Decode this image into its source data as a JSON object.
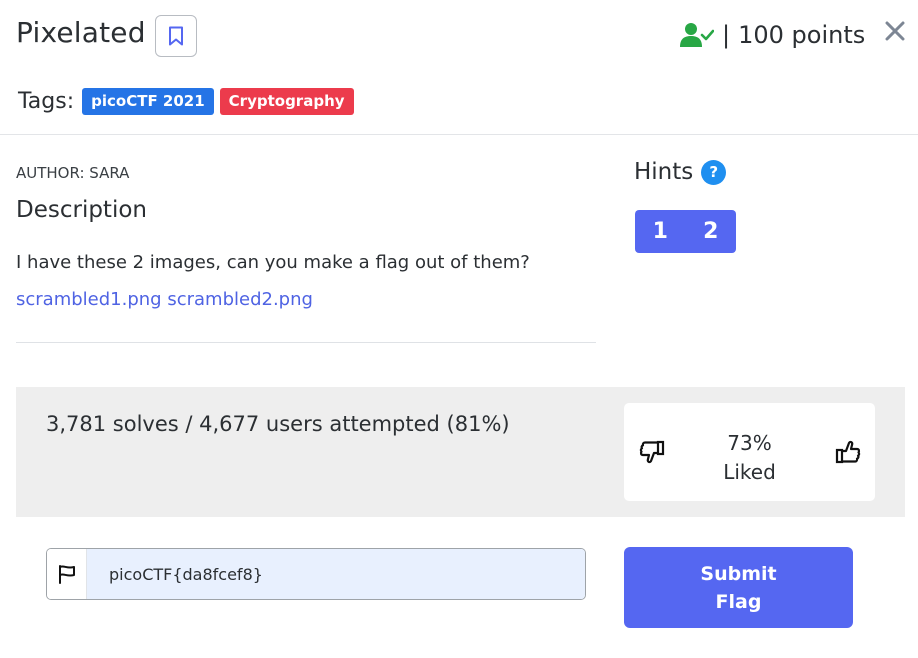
{
  "challenge": {
    "title": "Pixelated",
    "points": "100 points",
    "separator": "|"
  },
  "tags": {
    "label": "Tags:",
    "items": [
      {
        "text": "picoCTF 2021",
        "color": "#2574e6"
      },
      {
        "text": "Cryptography",
        "color": "#ec3b4c"
      }
    ]
  },
  "description": {
    "author": "AUTHOR: SARA",
    "heading": "Description",
    "text": "I have these 2 images, can you make a flag out of them?",
    "files": [
      "scrambled1.png",
      "scrambled2.png"
    ]
  },
  "hints": {
    "title": "Hints",
    "help_glyph": "?",
    "buttons": [
      "1",
      "2"
    ]
  },
  "stats": {
    "solves_text": "3,781 solves / 4,677 users attempted (81%)",
    "liked_pct": "73%",
    "liked_label": "Liked"
  },
  "flag_form": {
    "value": "picoCTF{da8fcef8}",
    "submit_label": "Submit Flag"
  },
  "icons": {
    "bookmark": "bookmark-icon",
    "solved_user": "user-check-icon",
    "close": "close-icon",
    "thumbs_down": "thumbs-down-icon",
    "thumbs_up": "thumbs-up-icon",
    "flag": "flag-icon"
  },
  "colors": {
    "accent": "#5567f1",
    "solved_green": "#28a745",
    "link": "#4f63e3",
    "panel_bg": "#eeeeee"
  }
}
